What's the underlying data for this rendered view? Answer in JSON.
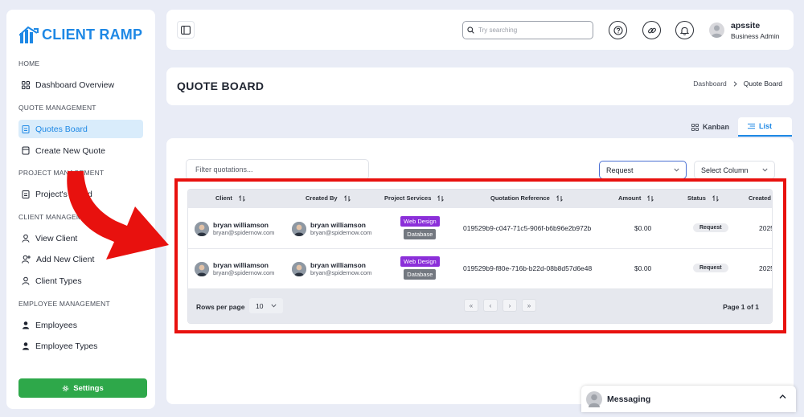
{
  "app": {
    "name": "CLIENT RAMP",
    "brand_color": "#1e88e5"
  },
  "sidebar": {
    "sections": [
      {
        "label": "HOME"
      },
      {
        "label": "QUOTE MANAGEMENT"
      },
      {
        "label": "PROJECT MANAGEMENT"
      },
      {
        "label": "CLIENT MANAGEMENT"
      },
      {
        "label": "EMPLOYEE MANAGEMENT"
      }
    ],
    "items": [
      {
        "label": "Dashboard Overview",
        "icon": "grid-icon"
      },
      {
        "label": "Quotes Board",
        "icon": "clipboard-icon",
        "active": true
      },
      {
        "label": "Create New Quote",
        "icon": "document-icon"
      },
      {
        "label": "Project's Board",
        "icon": "clipboard-icon"
      },
      {
        "label": "View Client",
        "icon": "user-icon"
      },
      {
        "label": "Add New Client",
        "icon": "user-plus-icon"
      },
      {
        "label": "Client Types",
        "icon": "user-icon"
      },
      {
        "label": "Employees",
        "icon": "user-icon"
      },
      {
        "label": "Employee Types",
        "icon": "user-icon"
      }
    ],
    "settings_label": "Settings",
    "settings_color": "#2ea84a"
  },
  "header": {
    "search_placeholder": "Try searching",
    "user_name": "apssite",
    "user_role": "Business Admin"
  },
  "page": {
    "title": "QUOTE BOARD",
    "breadcrumb": [
      "Dashboard",
      "Quote Board"
    ]
  },
  "view_tabs": {
    "kanban": "Kanban",
    "list": "List"
  },
  "filters": {
    "filter_placeholder": "Filter quotations...",
    "status_select": "Request",
    "column_select": "Select Column"
  },
  "table": {
    "columns": [
      "Client",
      "Created By",
      "Project Services",
      "Quotation Reference",
      "Amount",
      "Status",
      "Created"
    ],
    "rows": [
      {
        "client_name": "bryan williamson",
        "client_email": "bryan@spidernow.com",
        "creator_name": "bryan williamson",
        "creator_email": "bryan@spidernow.com",
        "services": [
          "Web Design",
          "Database"
        ],
        "reference": "019529b9-c047-71c5-906f-b6b96e2b972b",
        "amount": "$0.00",
        "status": "Request",
        "created": "2025"
      },
      {
        "client_name": "bryan williamson",
        "client_email": "bryan@spidernow.com",
        "creator_name": "bryan williamson",
        "creator_email": "bryan@spidernow.com",
        "services": [
          "Web Design",
          "Database"
        ],
        "reference": "019529b9-f80e-716b-b22d-08b8d57d6e48",
        "amount": "$0.00",
        "status": "Request",
        "created": "2025"
      }
    ],
    "rows_per_page_label": "Rows per page",
    "rows_per_page": "10",
    "pager": {
      "first": "«",
      "prev": "‹",
      "next": "›",
      "last": "»"
    },
    "page_info": "Page 1 of 1"
  },
  "messaging": {
    "label": "Messaging"
  },
  "annotation": {
    "highlight_color": "#e8110e"
  }
}
